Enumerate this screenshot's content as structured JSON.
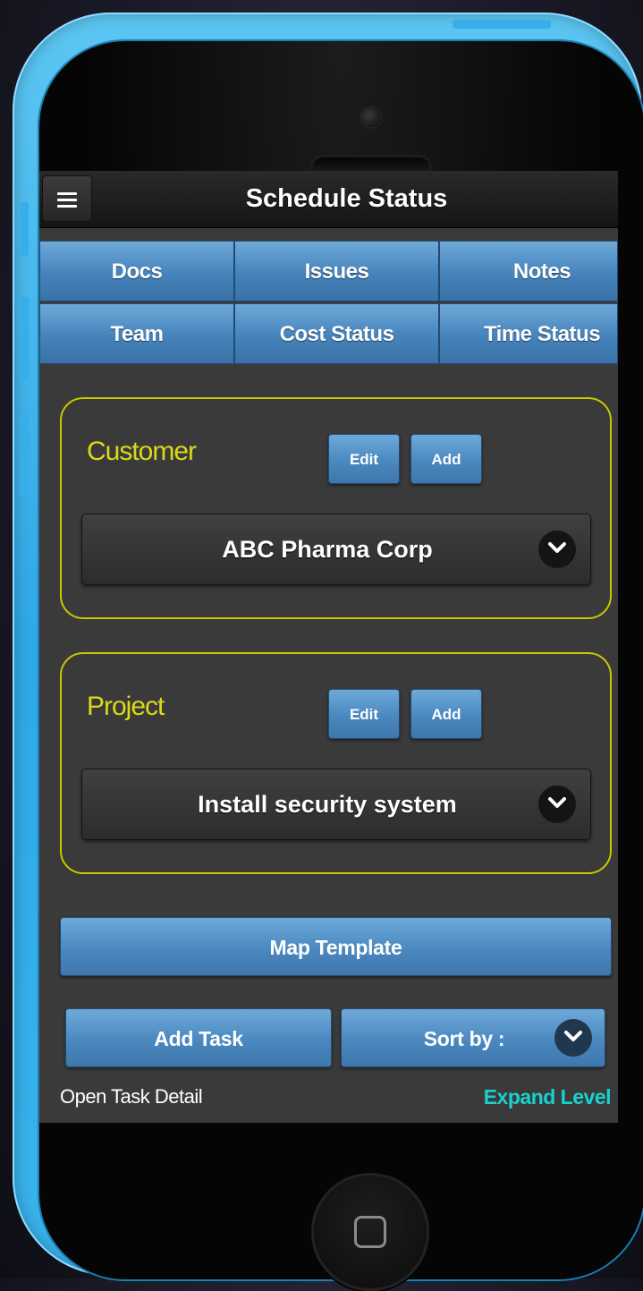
{
  "header": {
    "title": "Schedule Status",
    "menu_icon": "hamburger-icon"
  },
  "tabs": [
    {
      "label": "Docs"
    },
    {
      "label": "Issues"
    },
    {
      "label": "Notes"
    },
    {
      "label": "Team"
    },
    {
      "label": "Cost Status"
    },
    {
      "label": "Time Status"
    }
  ],
  "customer": {
    "label": "Customer",
    "edit_label": "Edit",
    "add_label": "Add",
    "selected": "ABC Pharma Corp"
  },
  "project": {
    "label": "Project",
    "edit_label": "Edit",
    "add_label": "Add",
    "selected": "Install security system"
  },
  "actions": {
    "map_template": "Map Template",
    "add_task": "Add Task",
    "sort_by": "Sort by :"
  },
  "footer": {
    "open_task_detail": "Open Task Detail",
    "expand_level": "Expand Level"
  },
  "colors": {
    "accent_blue": "#4a88c0",
    "panel_border": "#c9c800",
    "label_yellow": "#dada1a",
    "link_teal": "#19d1cf",
    "phone_case": "#2fa8e6"
  }
}
